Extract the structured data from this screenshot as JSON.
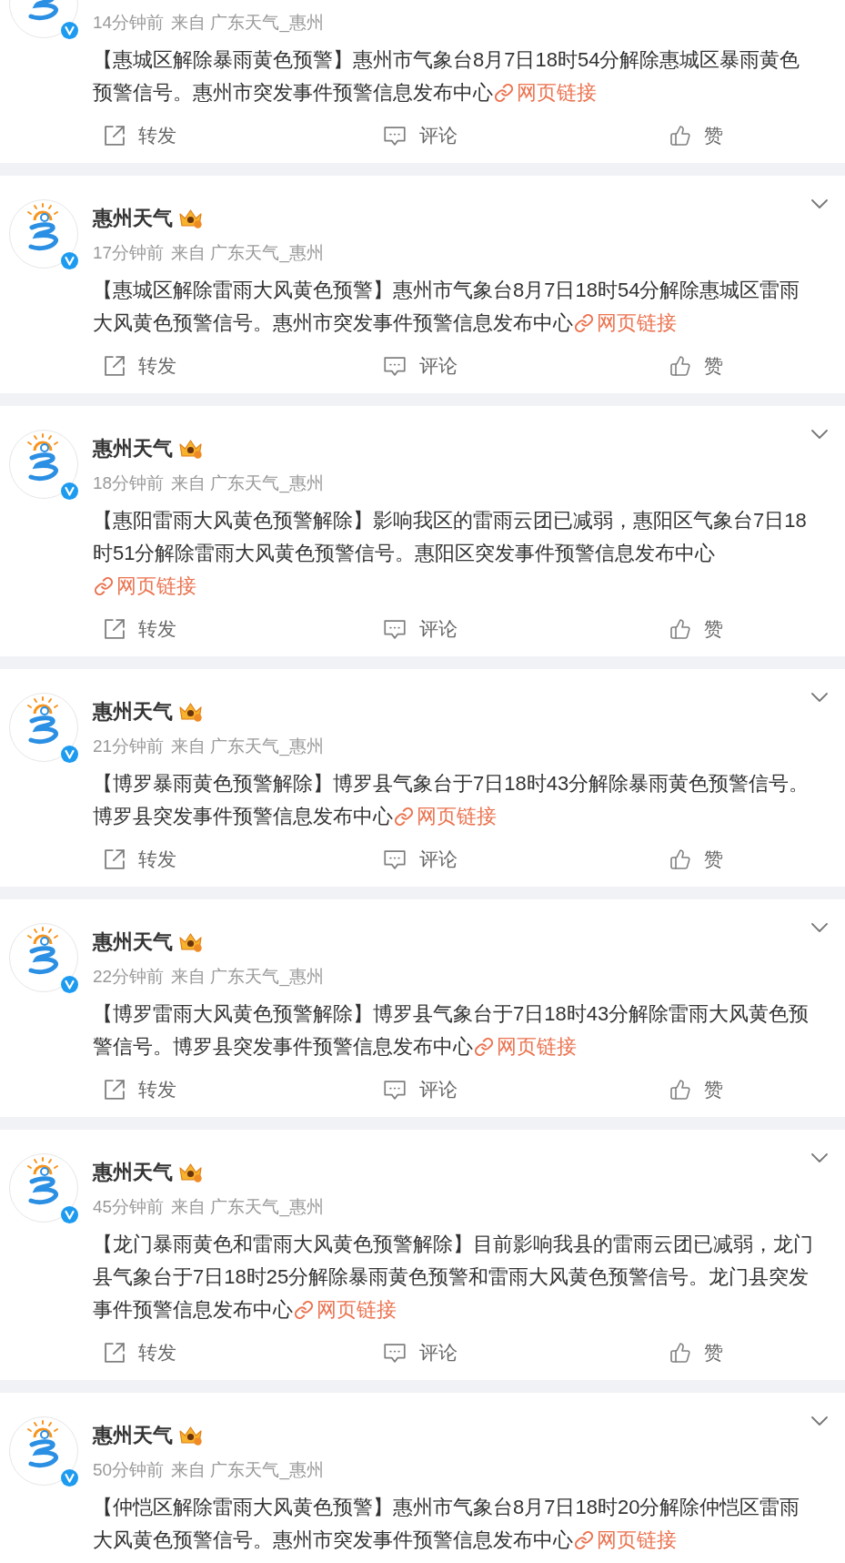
{
  "posts": [
    {
      "kind": "partial",
      "verified": true,
      "time": "14分钟前",
      "source": "来自 广东天气_惠州",
      "text": "【惠城区解除暴雨黄色预警】惠州市气象台8月7日18时54分解除惠城区暴雨黄色预警信号。惠州市突发事件预警信息发布中心",
      "link": "网页链接",
      "actions": [
        {
          "kind": "repost",
          "label": "转发"
        },
        {
          "kind": "comment",
          "label": "评论"
        },
        {
          "kind": "like",
          "label": "赞"
        }
      ]
    },
    {
      "kind": "full",
      "verified": true,
      "author": "惠州天气",
      "time": "17分钟前",
      "source": "来自 广东天气_惠州",
      "text": "【惠城区解除雷雨大风黄色预警】惠州市气象台8月7日18时54分解除惠城区雷雨大风黄色预警信号。惠州市突发事件预警信息发布中心",
      "link": "网页链接",
      "actions": [
        {
          "kind": "repost",
          "label": "转发"
        },
        {
          "kind": "comment",
          "label": "评论"
        },
        {
          "kind": "like",
          "label": "赞"
        }
      ]
    },
    {
      "kind": "full",
      "verified": true,
      "author": "惠州天气",
      "time": "18分钟前",
      "source": "来自 广东天气_惠州",
      "text": "【惠阳雷雨大风黄色预警解除】影响我区的雷雨云团已减弱，惠阳区气象台7日18时51分解除雷雨大风黄色预警信号。惠阳区突发事件预警信息发布中心",
      "link": "网页链接",
      "actions": [
        {
          "kind": "repost",
          "label": "转发"
        },
        {
          "kind": "comment",
          "label": "评论"
        },
        {
          "kind": "like",
          "label": "赞"
        }
      ]
    },
    {
      "kind": "full",
      "verified": true,
      "author": "惠州天气",
      "time": "21分钟前",
      "source": "来自 广东天气_惠州",
      "text": "【博罗暴雨黄色预警解除】博罗县气象台于7日18时43分解除暴雨黄色预警信号。博罗县突发事件预警信息发布中心",
      "link": "网页链接",
      "actions": [
        {
          "kind": "repost",
          "label": "转发"
        },
        {
          "kind": "comment",
          "label": "评论"
        },
        {
          "kind": "like",
          "label": "赞"
        }
      ]
    },
    {
      "kind": "full",
      "verified": true,
      "author": "惠州天气",
      "time": "22分钟前",
      "source": "来自 广东天气_惠州",
      "text": "【博罗雷雨大风黄色预警解除】博罗县气象台于7日18时43分解除雷雨大风黄色预警信号。博罗县突发事件预警信息发布中心",
      "link": "网页链接",
      "actions": [
        {
          "kind": "repost",
          "label": "转发"
        },
        {
          "kind": "comment",
          "label": "评论"
        },
        {
          "kind": "like",
          "label": "赞"
        }
      ]
    },
    {
      "kind": "full",
      "verified": true,
      "author": "惠州天气",
      "time": "45分钟前",
      "source": "来自 广东天气_惠州",
      "text": "【龙门暴雨黄色和雷雨大风黄色预警解除】目前影响我县的雷雨云团已减弱，龙门县气象台于7日18时25分解除暴雨黄色预警和雷雨大风黄色预警信号。龙门县突发事件预警信息发布中心",
      "link": "网页链接",
      "actions": [
        {
          "kind": "repost",
          "label": "转发"
        },
        {
          "kind": "comment",
          "label": "评论"
        },
        {
          "kind": "like",
          "label": "赞"
        }
      ]
    },
    {
      "kind": "full",
      "verified": true,
      "author": "惠州天气",
      "time": "50分钟前",
      "source": "来自 广东天气_惠州",
      "text": "【仲恺区解除雷雨大风黄色预警】惠州市气象台8月7日18时20分解除仲恺区雷雨大风黄色预警信号。惠州市突发事件预警信息发布中心",
      "link": "网页链接"
    }
  ]
}
